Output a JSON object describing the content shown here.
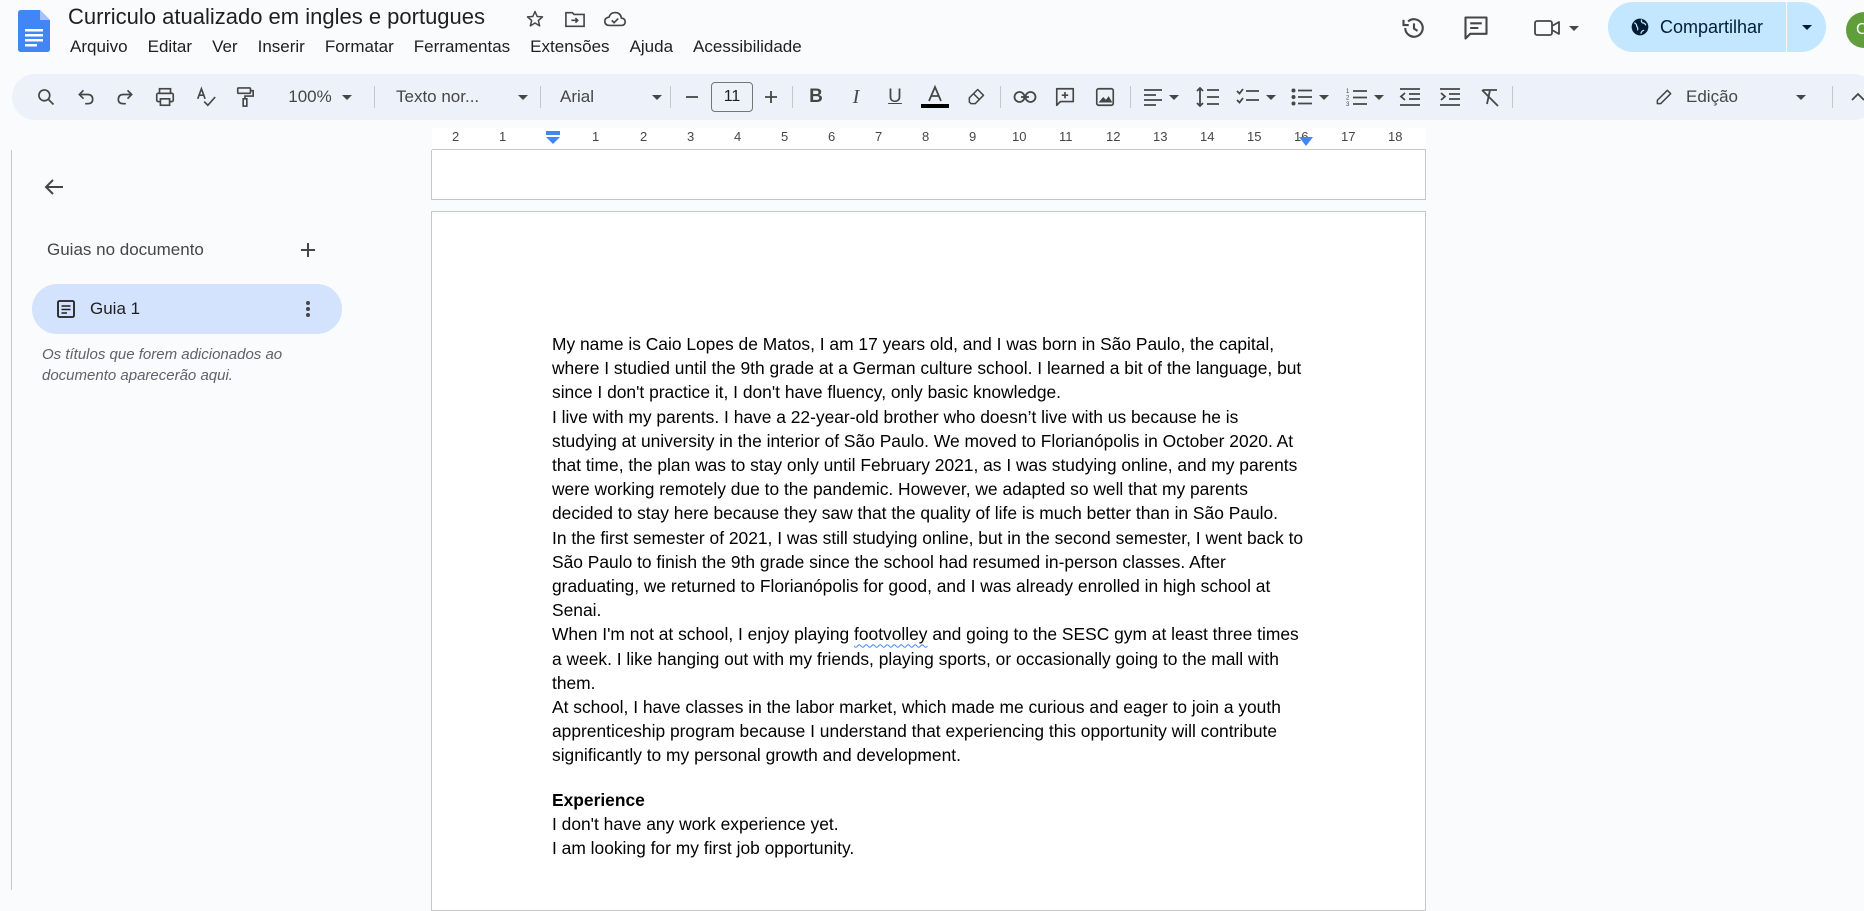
{
  "app": {
    "doc_title": "Curriculo atualizado em ingles e portugues",
    "menu": [
      "Arquivo",
      "Editar",
      "Ver",
      "Inserir",
      "Formatar",
      "Ferramentas",
      "Extensões",
      "Ajuda",
      "Acessibilidade"
    ],
    "share_label": "Compartilhar",
    "avatar_initial": "C"
  },
  "toolbar": {
    "zoom": "100%",
    "style": "Texto nor...",
    "font": "Arial",
    "font_size": "11",
    "mode": "Edição"
  },
  "ruler": {
    "labels": [
      "2",
      "1",
      "1",
      "2",
      "3",
      "4",
      "5",
      "6",
      "7",
      "8",
      "9",
      "10",
      "11",
      "12",
      "13",
      "14",
      "15",
      "16",
      "17",
      "18"
    ]
  },
  "sidebar": {
    "title": "Guias no documento",
    "tab_label": "Guia 1",
    "hint": "Os títulos que forem adicionados ao documento aparecerão aqui."
  },
  "document": {
    "p1": "My name is Caio Lopes de Matos, I am 17 years old, and I was born in São Paulo, the capital, where I studied until the 9th grade at a German culture school. I learned a bit of the language, but since I don't practice it, I don't have fluency, only basic knowledge.",
    "p2": "I live with my parents. I have a 22-year-old brother who doesn’t live with us because he is studying at university in the interior of São Paulo. We moved to Florianópolis in October 2020. At that time, the plan was to stay only until February 2021, as I was studying online, and my parents were working remotely due to the pandemic. However, we adapted so well that my parents decided to stay here because they saw that the quality of life is much better than in São Paulo.",
    "p3": "In the first semester of 2021, I was still studying online, but in the second semester, I went back to São Paulo to finish the 9th grade since the school had resumed in-person classes. After graduating, we returned to Florianópolis for good, and I was already enrolled in high school at Senai.",
    "p4_before": "When I'm not at school, I enjoy playing ",
    "p4_misspelled": "footvolley",
    "p4_after": " and going to the SESC gym at least three times a week. I like hanging out with my friends, playing sports, or occasionally going to the mall with them.",
    "p5": "At school, I have classes in the labor market, which made me curious and eager to join a youth apprenticeship program because I understand that experiencing this opportunity will contribute significantly to my personal growth and development.",
    "heading": "Experience",
    "p6": "I don't have any work experience yet.",
    "p7": "I am looking for my first job opportunity."
  }
}
